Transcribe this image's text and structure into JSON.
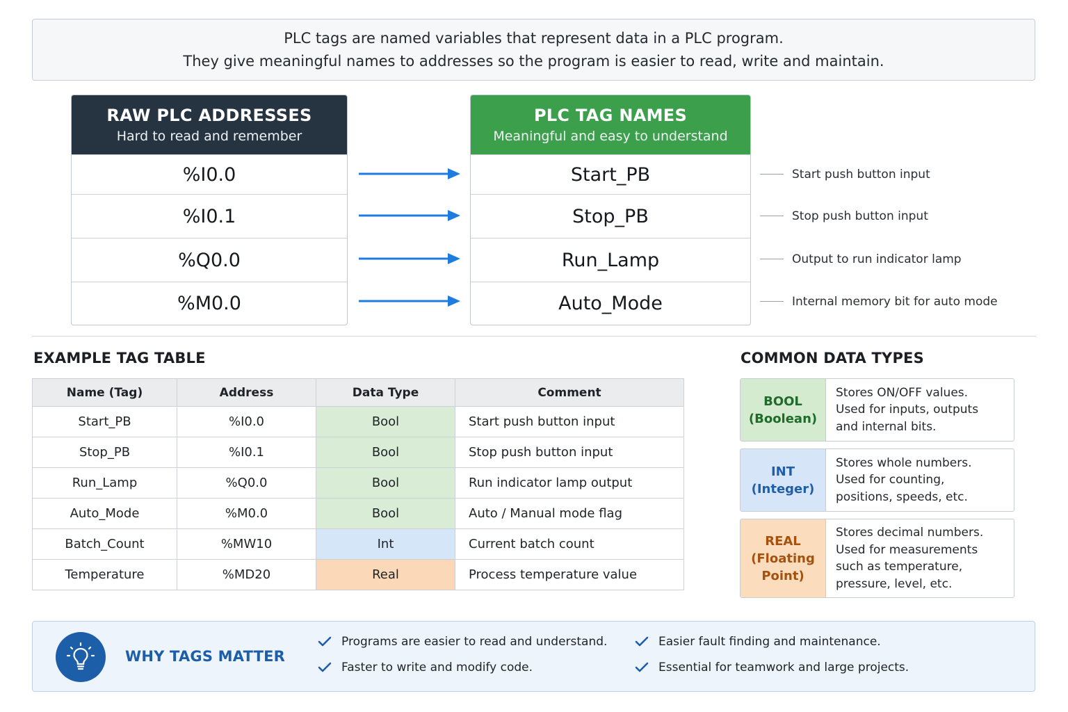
{
  "intro": {
    "line1": "PLC tags are named variables that represent data in a PLC program.",
    "line2": "They give meaningful names to addresses so the program is easier to read, write and maintain."
  },
  "raw": {
    "title": "RAW PLC ADDRESSES",
    "subtitle": "Hard to read and remember",
    "items": [
      "%I0.0",
      "%I0.1",
      "%Q0.0",
      "%M0.0"
    ]
  },
  "tags": {
    "title": "PLC TAG NAMES",
    "subtitle": "Meaningful and easy to understand",
    "items": [
      "Start_PB",
      "Stop_PB",
      "Run_Lamp",
      "Auto_Mode"
    ],
    "notes": [
      "Start push button input",
      "Stop push button input",
      "Output to run indicator lamp",
      "Internal memory bit for auto mode"
    ]
  },
  "colors": {
    "raw_header": "#263341",
    "tag_header": "#3c9f4c",
    "arrow": "#1e7be0",
    "bool": "#d9edd6",
    "int": "#d5e6f8",
    "real": "#fbd8b8",
    "accent_blue": "#1d5ea9"
  },
  "example_table": {
    "title": "EXAMPLE TAG TABLE",
    "headers": [
      "Name (Tag)",
      "Address",
      "Data Type",
      "Comment"
    ],
    "rows": [
      {
        "name": "Start_PB",
        "address": "%I0.0",
        "type": "Bool",
        "comment": "Start push button input"
      },
      {
        "name": "Stop_PB",
        "address": "%I0.1",
        "type": "Bool",
        "comment": "Stop push button input"
      },
      {
        "name": "Run_Lamp",
        "address": "%Q0.0",
        "type": "Bool",
        "comment": "Run indicator lamp output"
      },
      {
        "name": "Auto_Mode",
        "address": "%M0.0",
        "type": "Bool",
        "comment": "Auto / Manual mode flag"
      },
      {
        "name": "Batch_Count",
        "address": "%MW10",
        "type": "Int",
        "comment": "Current batch count"
      },
      {
        "name": "Temperature",
        "address": "%MD20",
        "type": "Real",
        "comment": "Process temperature value"
      }
    ]
  },
  "data_types": {
    "title": "COMMON DATA TYPES",
    "items": [
      {
        "badge_line1": "BOOL",
        "badge_line2": "(Boolean)",
        "badge_line3": "",
        "desc": [
          "Stores ON/OFF values.",
          "Used for inputs, outputs",
          "and internal bits."
        ]
      },
      {
        "badge_line1": "INT",
        "badge_line2": "(Integer)",
        "badge_line3": "",
        "desc": [
          "Stores whole numbers.",
          "Used for counting,",
          "positions, speeds, etc."
        ]
      },
      {
        "badge_line1": "REAL",
        "badge_line2": "(Floating",
        "badge_line3": "Point)",
        "desc": [
          "Stores decimal numbers.",
          "Used for measurements",
          "such as temperature,",
          "pressure, level, etc."
        ]
      }
    ]
  },
  "why": {
    "title": "WHY TAGS MATTER",
    "icon": "lightbulb-icon",
    "items": [
      "Programs are easier to read and understand.",
      "Faster to write and modify code.",
      "Easier fault finding and maintenance.",
      "Essential for teamwork and large projects."
    ]
  }
}
